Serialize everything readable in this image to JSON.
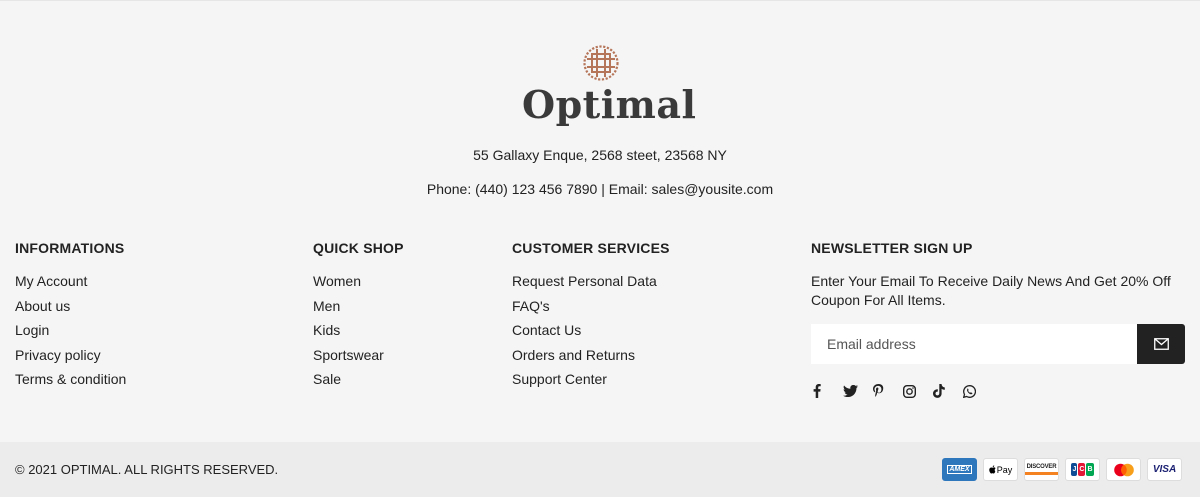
{
  "brand": {
    "name": "Optimal",
    "color": "#b57559"
  },
  "store": {
    "address": "55 Gallaxy Enque, 2568 steet, 23568 NY",
    "contact_line": "Phone: (440) 123 456 7890 | Email: sales@yousite.com"
  },
  "informations": {
    "heading": "INFORMATIONS",
    "items": [
      "My Account",
      "About us",
      "Login",
      "Privacy policy",
      "Terms & condition"
    ]
  },
  "quick_shop": {
    "heading": "QUICK SHOP",
    "items": [
      "Women",
      "Men",
      "Kids",
      "Sportswear",
      "Sale"
    ]
  },
  "customer_services": {
    "heading": "CUSTOMER SERVICES",
    "items": [
      "Request Personal Data",
      "FAQ's",
      "Contact Us",
      "Orders and Returns",
      "Support Center"
    ]
  },
  "newsletter": {
    "heading": "NEWSLETTER SIGN UP",
    "text": "Enter Your Email To Receive Daily News And Get 20% Off Coupon For All Items.",
    "placeholder": "Email address",
    "button_icon": "envelope-icon"
  },
  "socials": [
    "facebook-icon",
    "twitter-icon",
    "pinterest-icon",
    "instagram-icon",
    "tiktok-icon",
    "whatsapp-icon"
  ],
  "footer": {
    "copyright": "© 2021 OPTIMAL. ALL RIGHTS RESERVED.",
    "payments": [
      {
        "name": "amex-icon",
        "label": "AMEX",
        "bg": "#2e77bc",
        "fg": "#ffffff"
      },
      {
        "name": "apple-pay-icon",
        "label": "Pay",
        "bg": "#ffffff",
        "fg": "#000000"
      },
      {
        "name": "discover-icon",
        "label": "DISCOVER",
        "bg": "#ffffff",
        "fg": "#222222"
      },
      {
        "name": "jcb-icon",
        "label": "JCB",
        "bg": "#ffffff",
        "fg": "#0e4c96"
      },
      {
        "name": "mastercard-icon",
        "label": "",
        "bg": "#ffffff",
        "fg": "#000000"
      },
      {
        "name": "visa-icon",
        "label": "VISA",
        "bg": "#ffffff",
        "fg": "#1a1f71"
      }
    ]
  }
}
